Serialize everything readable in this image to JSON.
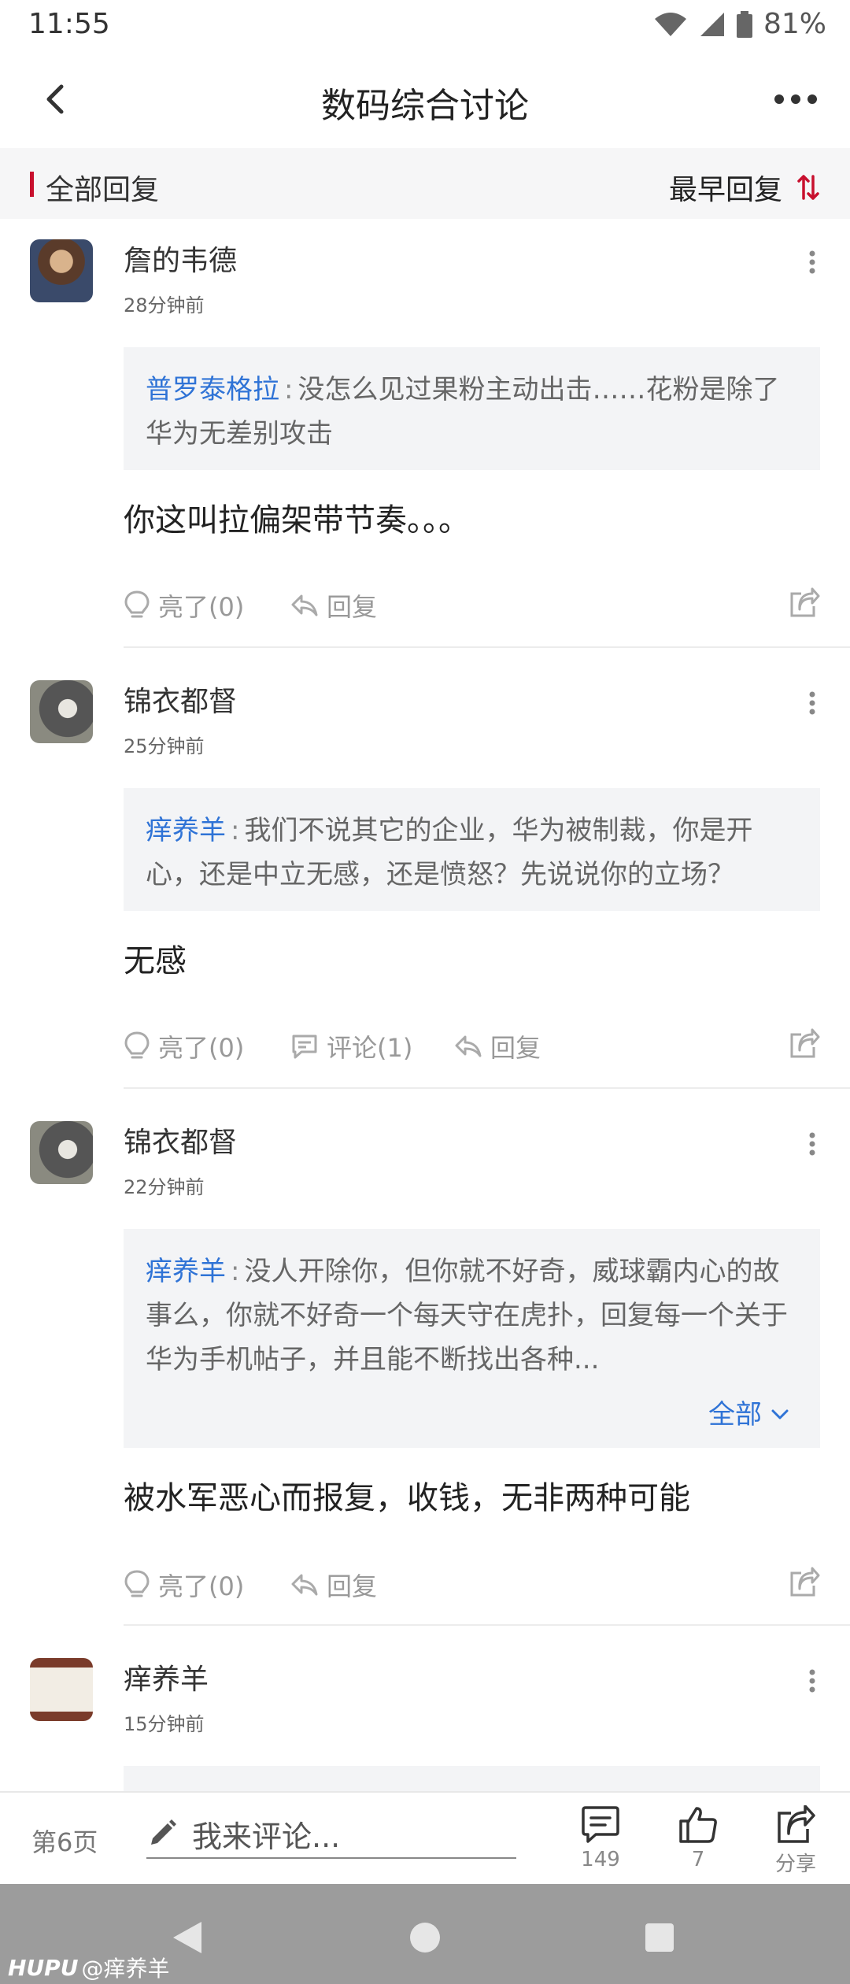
{
  "status": {
    "time": "11:55",
    "battery": "81%"
  },
  "header": {
    "title": "数码综合讨论"
  },
  "filter": {
    "left_label": "全部回复",
    "sort_label": "最早回复"
  },
  "replies": [
    {
      "user": "詹的韦德",
      "time": "28分钟前",
      "quote_user": "普罗泰格拉",
      "quote_sep": ":",
      "quote_text": "没怎么见过果粉主动出击……花粉是除了华为无差别攻击",
      "text": "你这叫拉偏架带节奏。。。",
      "like_label": "亮了(0)",
      "reply_label": "回复"
    },
    {
      "user": "锦衣都督",
      "time": "25分钟前",
      "quote_user": "痒养羊",
      "quote_sep": ":",
      "quote_text": "我们不说其它的企业，华为被制裁，你是开心，还是中立无感，还是愤怒？先说说你的立场？",
      "text": "无感",
      "like_label": "亮了(0)",
      "comment_label": "评论(1)",
      "reply_label": "回复"
    },
    {
      "user": "锦衣都督",
      "time": "22分钟前",
      "quote_user": "痒养羊",
      "quote_sep": ":",
      "quote_text": "没人开除你，但你就不好奇，威球霸内心的故事么，你就不好奇一个每天守在虎扑，回复每一个关于华为手机帖子，并且能不断找出各种...",
      "expand_label": "全部",
      "text": "被水军恶心而报复，收钱，无非两种可能",
      "like_label": "亮了(0)",
      "reply_label": "回复"
    },
    {
      "user": "痒养羊",
      "time": "15分钟前"
    }
  ],
  "bottom": {
    "page": "第6页",
    "comment_placeholder": "我来评论...",
    "comments_count": "149",
    "likes_count": "7",
    "share_label": "分享"
  },
  "watermark": {
    "brand": "HUPU",
    "handle": "@痒养羊"
  },
  "colors": {
    "accent_red": "#c8102e",
    "link_blue": "#2f73d6",
    "quote_bg": "#f3f4f6",
    "nav_bg": "#9c9c9c"
  }
}
